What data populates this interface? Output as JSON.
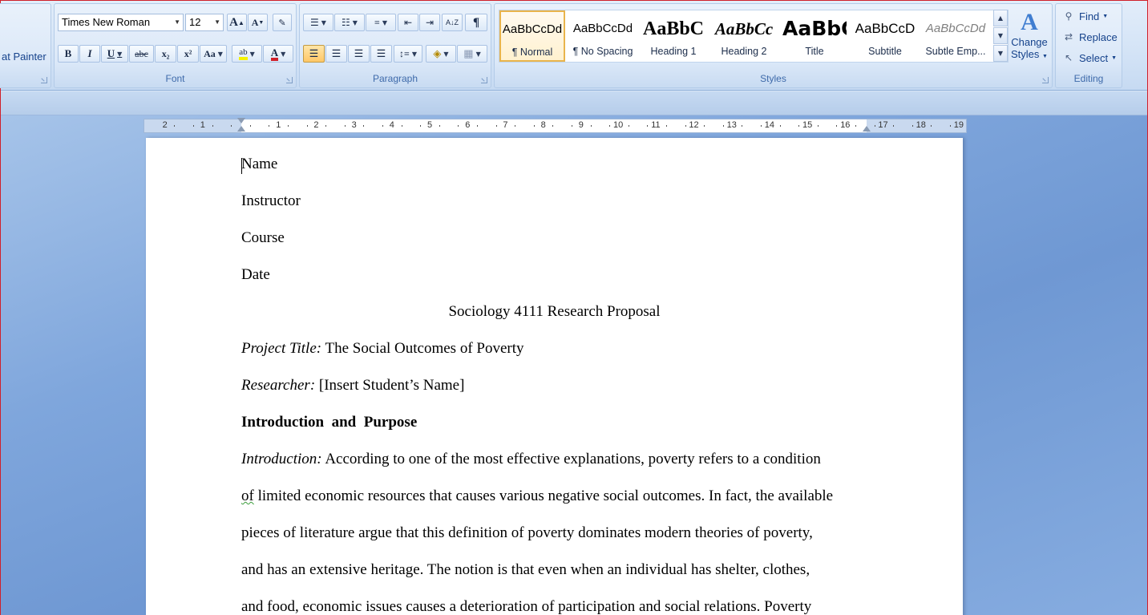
{
  "clipboard": {
    "format_painter_label": "at Painter"
  },
  "font": {
    "group_label": "Font",
    "font_name": "Times New Roman",
    "font_size": "12",
    "grow_label": "A",
    "shrink_label": "A",
    "bold_label": "B",
    "italic_label": "I",
    "underline_label": "U",
    "strike_label": "abc",
    "subscript_label": "x₂",
    "superscript_label": "x²",
    "change_case_label": "Aa",
    "highlight_label": "ab",
    "font_color_label": "A"
  },
  "paragraph": {
    "group_label": "Paragraph",
    "pilcrow_label": "¶",
    "sort_label": "A↓Z"
  },
  "styles": {
    "group_label": "Styles",
    "tiles": [
      {
        "sample": "AaBbCcDd",
        "name": "¶ Normal"
      },
      {
        "sample": "AaBbCcDd",
        "name": "¶ No Spacing"
      },
      {
        "sample": "AaBbC",
        "name": "Heading 1"
      },
      {
        "sample": "AaBbCc",
        "name": "Heading 2"
      },
      {
        "sample": "AaBbC",
        "name": "Title"
      },
      {
        "sample": "AaBbCcD",
        "name": "Subtitle"
      },
      {
        "sample": "AaBbCcDd",
        "name": "Subtle Emp..."
      }
    ],
    "change_styles_line1": "Change",
    "change_styles_line2": "Styles"
  },
  "editing": {
    "group_label": "Editing",
    "find_label": "Find",
    "replace_label": "Replace",
    "select_label": "Select"
  },
  "ruler": {
    "left_numbers": [
      "2",
      "1"
    ],
    "right_numbers": [
      "1",
      "2",
      "3",
      "4",
      "5",
      "6",
      "7",
      "8",
      "9",
      "10",
      "11",
      "12",
      "13",
      "14",
      "15",
      "16",
      "17",
      "18",
      "19"
    ]
  },
  "document": {
    "name": "Name",
    "instructor": "Instructor",
    "course": "Course",
    "date": "Date",
    "title": "Sociology 4111 Research Proposal",
    "project_title_label": "Project Title:",
    "project_title_value": " The Social Outcomes of Poverty",
    "researcher_label": "Researcher:",
    "researcher_value": " [Insert Student’s Name]",
    "heading": "Introduction  and  Purpose",
    "intro_label": "Introduction:",
    "intro_line1": " According to one of the most effective explanations, poverty refers to a condition",
    "intro_line2_squig": "of",
    "intro_line2": " limited economic resources that causes various negative social outcomes. In fact, the available",
    "intro_line3": "pieces of literature argue that this definition of poverty dominates modern theories of poverty,",
    "intro_line4": "and has an extensive heritage. The notion is that even when an individual has shelter, clothes,",
    "intro_line5": "and food, economic issues causes a deterioration of participation and social relations. Poverty"
  }
}
